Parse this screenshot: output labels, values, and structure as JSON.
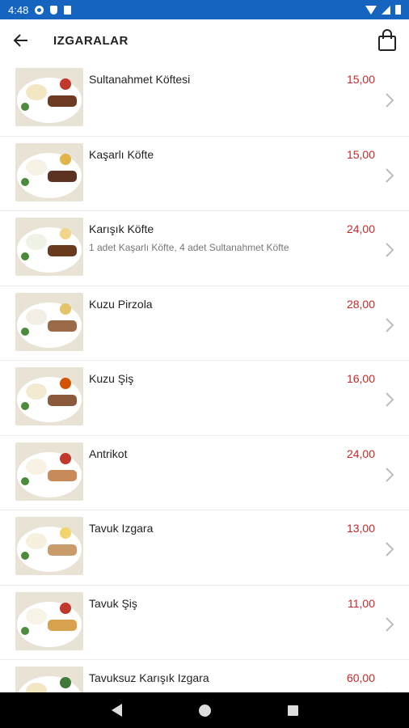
{
  "status_bar": {
    "time": "4:48"
  },
  "header": {
    "title": "IZGARALAR"
  },
  "items": [
    {
      "name": "Sultanahmet Köftesi",
      "desc": "",
      "price": "15,00"
    },
    {
      "name": "Kaşarlı Köfte",
      "desc": "",
      "price": "15,00"
    },
    {
      "name": "Karışık Köfte",
      "desc": "1 adet Kaşarlı Köfte, 4 adet Sultanahmet Köfte",
      "price": "24,00"
    },
    {
      "name": "Kuzu Pirzola",
      "desc": "",
      "price": "28,00"
    },
    {
      "name": "Kuzu Şiş",
      "desc": "",
      "price": "16,00"
    },
    {
      "name": "Antrikot",
      "desc": "",
      "price": "24,00"
    },
    {
      "name": "Tavuk Izgara",
      "desc": "",
      "price": "13,00"
    },
    {
      "name": "Tavuk Şiş",
      "desc": "",
      "price": "11,00"
    },
    {
      "name": "Tavuksuz Karışık Izgara",
      "desc": "",
      "price": "60,00"
    }
  ],
  "colors": {
    "status_bar": "#1565c0",
    "price": "#c62828",
    "nav_bar": "#000000"
  },
  "icons": {
    "back": "arrow-left-icon",
    "cart": "shopping-bag-icon",
    "chevron": "chevron-right-icon"
  }
}
